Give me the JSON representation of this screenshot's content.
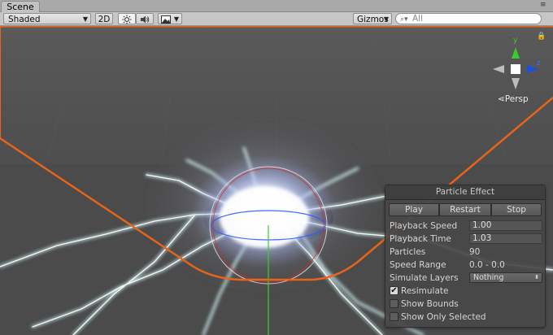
{
  "tab": {
    "label": "Scene"
  },
  "toolbar": {
    "shading_mode": "Shaded",
    "mode_2d": "2D",
    "lighting_icon": "sun-icon",
    "audio_icon": "speaker-icon",
    "effects_icon": "image-icon",
    "gizmos_label": "Gizmos",
    "search_placeholder": "All"
  },
  "scene": {
    "view_label": "Persp",
    "gizmo_axes": [
      "y",
      "z"
    ],
    "colors": {
      "outline": "#e8641a",
      "axis_y": "#3ccc2a",
      "axis_z": "#1a4fe0",
      "background": "#4b4b4b"
    }
  },
  "particle_panel": {
    "title": "Particle Effect",
    "buttons": {
      "play": "Play",
      "restart": "Restart",
      "stop": "Stop"
    },
    "playback_speed": {
      "label": "Playback Speed",
      "value": "1.00"
    },
    "playback_time": {
      "label": "Playback Time",
      "value": "1.03"
    },
    "particles": {
      "label": "Particles",
      "value": "90"
    },
    "speed_range": {
      "label": "Speed Range",
      "value": "0.0 - 0.0"
    },
    "simulate_layers": {
      "label": "Simulate Layers",
      "value": "Nothing"
    },
    "resimulate": {
      "label": "Resimulate",
      "checked": true
    },
    "show_bounds": {
      "label": "Show Bounds",
      "checked": false
    },
    "show_only_selected": {
      "label": "Show Only Selected",
      "checked": false
    }
  }
}
